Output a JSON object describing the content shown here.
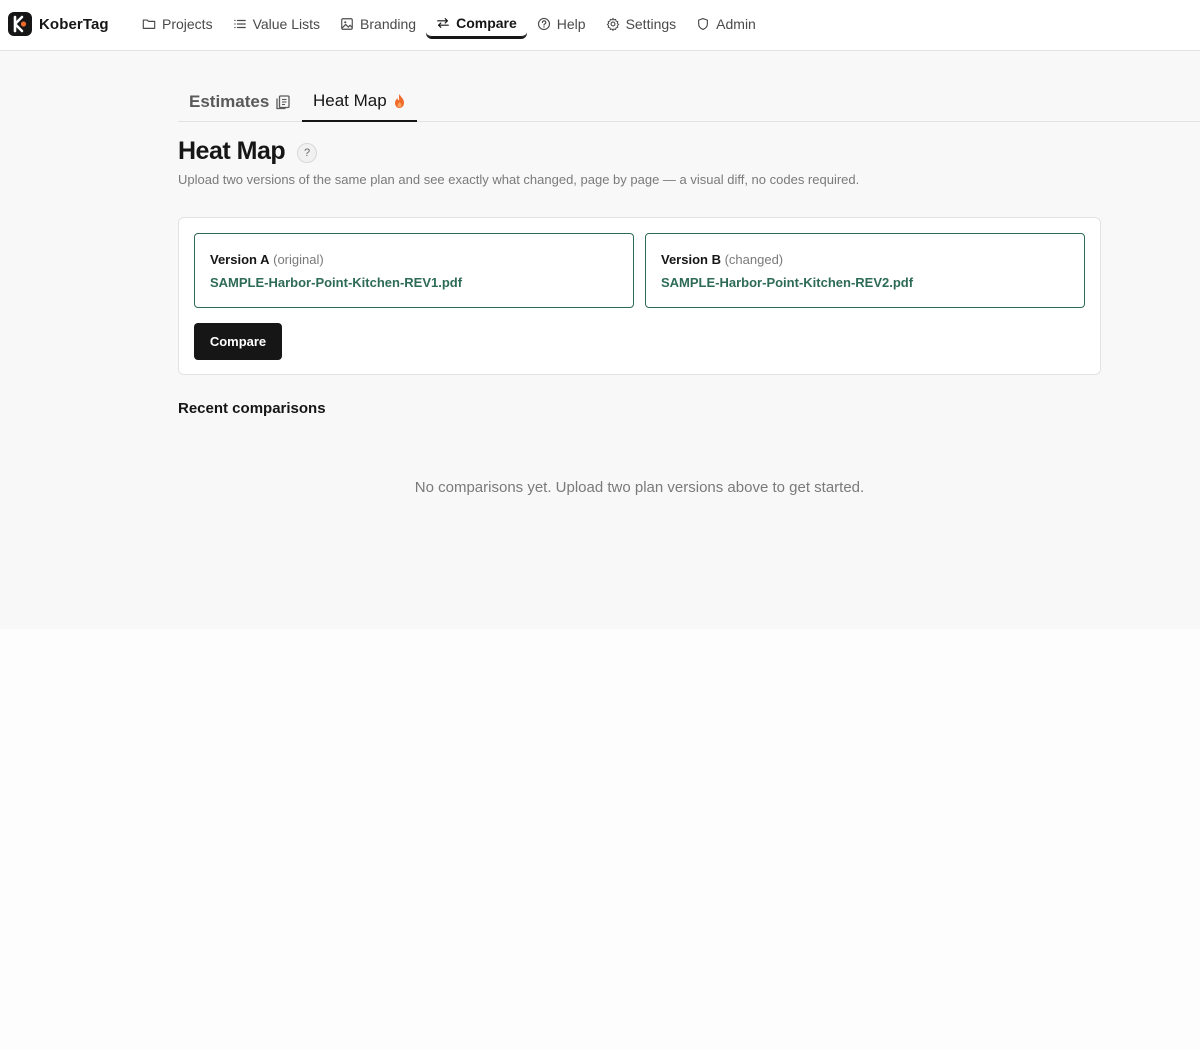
{
  "app": {
    "name": "KoberTag"
  },
  "nav": [
    {
      "label": "Projects",
      "icon": "folder-icon",
      "active": false
    },
    {
      "label": "Value Lists",
      "icon": "list-icon",
      "active": false
    },
    {
      "label": "Branding",
      "icon": "image-icon",
      "active": false
    },
    {
      "label": "Compare",
      "icon": "swap-icon",
      "active": true
    },
    {
      "label": "Help",
      "icon": "help-circle-icon",
      "active": false
    },
    {
      "label": "Settings",
      "icon": "gear-icon",
      "active": false
    },
    {
      "label": "Admin",
      "icon": "shield-icon",
      "active": false
    }
  ],
  "tabs": [
    {
      "label": "Estimates",
      "icon": "documents-icon",
      "active": false
    },
    {
      "label": "Heat Map",
      "icon": "flame-icon",
      "active": true
    }
  ],
  "page": {
    "title": "Heat Map",
    "help_glyph": "?",
    "subtitle": "Upload two versions of the same plan and see exactly what changed, page by page — a visual diff, no codes required."
  },
  "upload": {
    "version_a": {
      "name": "Version A",
      "note": "(original)",
      "file": "SAMPLE-Harbor-Point-Kitchen-REV1.pdf"
    },
    "version_b": {
      "name": "Version B",
      "note": "(changed)",
      "file": "SAMPLE-Harbor-Point-Kitchen-REV2.pdf"
    },
    "compare_label": "Compare"
  },
  "recent": {
    "title": "Recent comparisons",
    "empty_message": "No comparisons yet. Upload two plan versions above to get started."
  },
  "colors": {
    "accent": "#2e6b57",
    "primary_button": "#161616",
    "flame": "#f06a2a"
  }
}
